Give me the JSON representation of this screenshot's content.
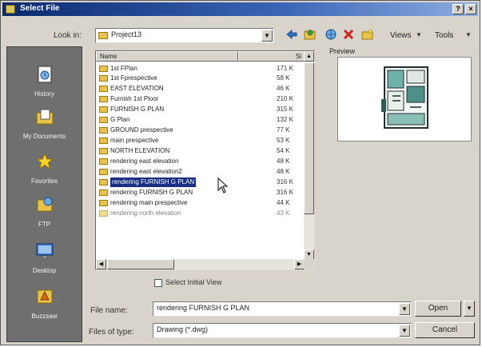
{
  "window": {
    "title": "Select File",
    "help_glyph": "?",
    "close_glyph": "×"
  },
  "toolbar": {
    "look_in_label": "Look in:",
    "look_in_value": "Project13",
    "views_label": "Views",
    "tools_label": "Tools",
    "dropdown_glyph": "▼"
  },
  "places": [
    {
      "label": "History",
      "icon": "history-icon"
    },
    {
      "label": "My Documents",
      "icon": "my-documents-icon"
    },
    {
      "label": "Favorites",
      "icon": "favorites-icon"
    },
    {
      "label": "FTP",
      "icon": "ftp-icon"
    },
    {
      "label": "Desktop",
      "icon": "desktop-icon"
    },
    {
      "label": "Buzzsaw",
      "icon": "buzzsaw-icon"
    }
  ],
  "file_list": {
    "columns": {
      "name": "Name",
      "size": "Si"
    },
    "files": [
      {
        "name": "1st FPlan",
        "size": "171 K"
      },
      {
        "name": "1st Fprespective",
        "size": "58 K"
      },
      {
        "name": "EAST ELEVATION",
        "size": "46 K"
      },
      {
        "name": "Furnish 1st Ploor",
        "size": "210 K"
      },
      {
        "name": "FURNISH G PLAN",
        "size": "315 K"
      },
      {
        "name": "G Plan",
        "size": "132 K"
      },
      {
        "name": "GROUND prespective",
        "size": "77 K"
      },
      {
        "name": "main prespective",
        "size": "53 K"
      },
      {
        "name": "NORTH ELEVATION",
        "size": "54 K"
      },
      {
        "name": "rendering east elevation",
        "size": "48 K"
      },
      {
        "name": "rendering east elevation2",
        "size": "48 K"
      },
      {
        "name": "rendering FURNISH G PLAN",
        "size": "316 K",
        "selected": true
      },
      {
        "name": "rendering FURNISH G PLAN",
        "size": "316 K"
      },
      {
        "name": "rendering main prespective",
        "size": "44 K"
      },
      {
        "name": "rendering north elevation",
        "size": "43 K"
      }
    ]
  },
  "preview": {
    "label": "Preview"
  },
  "options": {
    "select_initial_view": "Select Initial View"
  },
  "footer": {
    "file_name_label": "File name:",
    "file_name_value": "rendering FURNISH G PLAN",
    "file_type_label": "Files of type:",
    "file_type_value": "Drawing (*.dwg)",
    "open_label": "Open",
    "cancel_label": "Cancel"
  }
}
